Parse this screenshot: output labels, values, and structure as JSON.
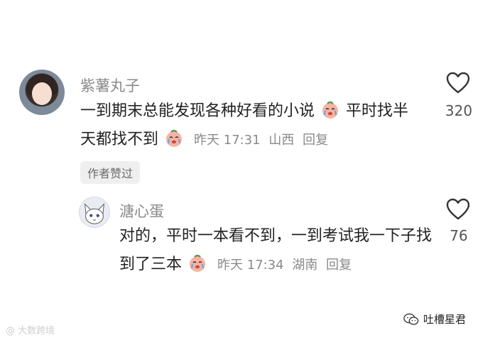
{
  "comments": [
    {
      "username": "紫薯丸子",
      "text_part1": "一到期末总能发现各种好看的小说",
      "text_part2": "平时找半天都找不到",
      "time": "昨天 17:31",
      "location": "山西",
      "reply_label": "回复",
      "like_count": "320",
      "author_liked_label": "作者赞过"
    },
    {
      "username": "溏心蛋",
      "text_part1": "对的，平时一本看不到，一到考试我一下子找到了三本",
      "time": "昨天 17:34",
      "location": "湖南",
      "reply_label": "回复",
      "like_count": "76"
    }
  ],
  "watermarks": {
    "left": "@ 大数跨境",
    "right": "吐槽星君"
  },
  "icons": {
    "emoji": "crying-face-emoji",
    "like": "heart-outline-icon",
    "wechat": "wechat-icon"
  },
  "colors": {
    "meta_text": "#8a8a8a",
    "body_text": "#222222",
    "badge_bg": "#efefef"
  }
}
